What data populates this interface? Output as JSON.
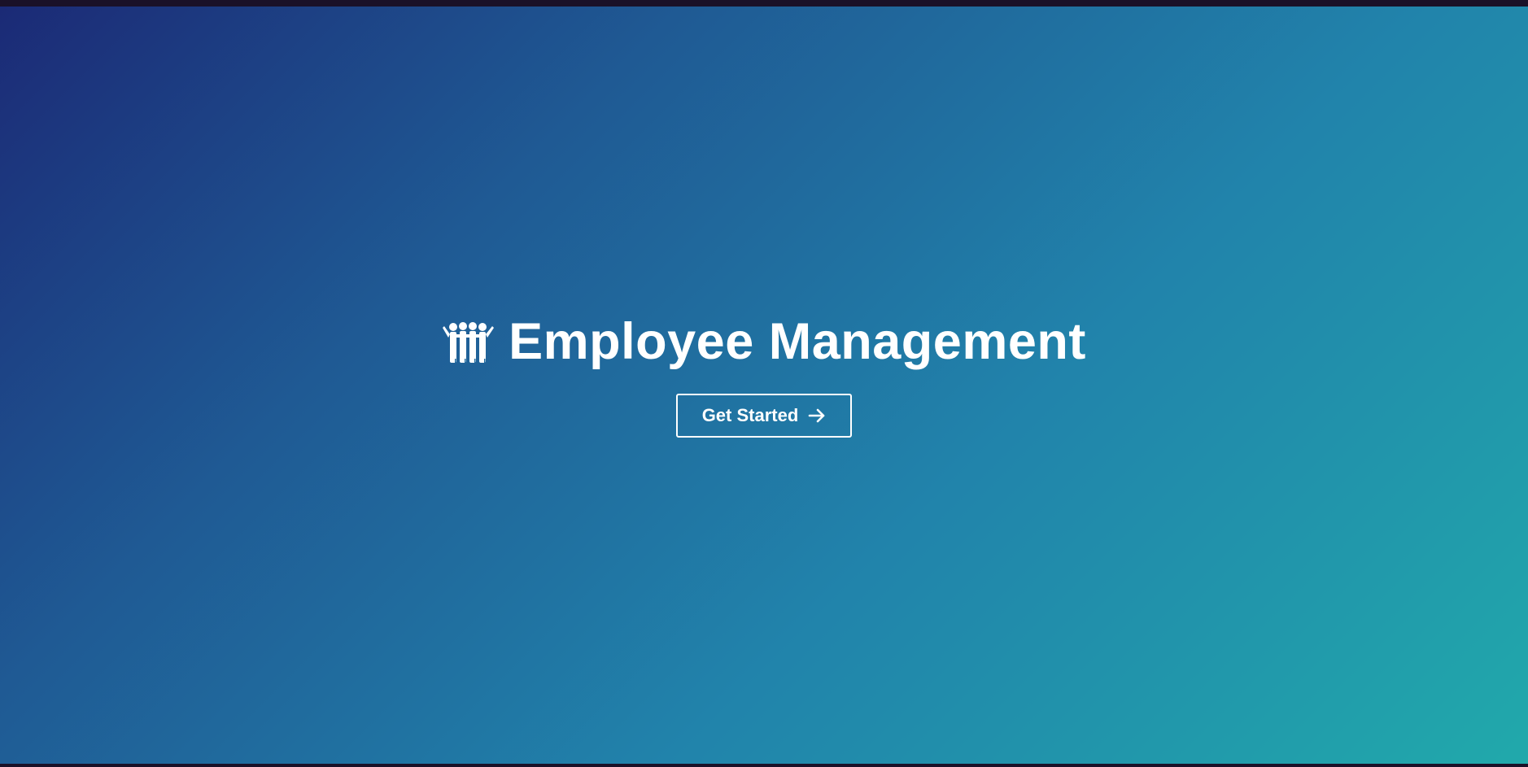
{
  "hero": {
    "title": "Employee Management",
    "icon": "people-group-icon",
    "cta_label": "Get Started",
    "cta_icon": "arrow-right-icon"
  },
  "colors": {
    "gradient_start": "#1b2a76",
    "gradient_end": "#21a9ab",
    "frame_border": "#1a1128",
    "text": "#ffffff"
  }
}
